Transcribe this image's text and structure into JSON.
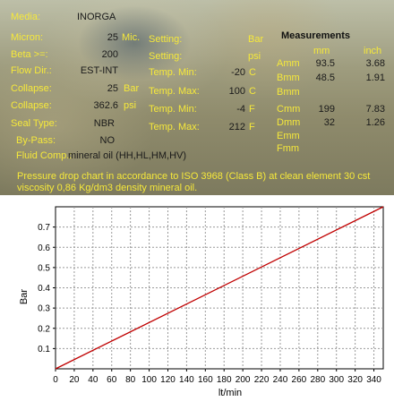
{
  "fields": {
    "media": {
      "label": "Media:",
      "value": "INORGANI"
    },
    "micron": {
      "label": "Micron:",
      "value": "25",
      "unit": "Mic."
    },
    "beta": {
      "label": "Beta >=:",
      "value": "200"
    },
    "flow_dir": {
      "label": "Flow Dir.:",
      "value": "EST-INT"
    },
    "collapse_bar": {
      "label": "Collapse:",
      "value": "25",
      "unit": "Bar"
    },
    "collapse_psi": {
      "label": "Collapse:",
      "value": "362.6",
      "unit": "psi"
    },
    "seal_type": {
      "label": "Seal Type:",
      "value": "NBR"
    },
    "by_pass": {
      "label": "By-Pass:",
      "value": "NO"
    },
    "fluid_comp": {
      "label": "Fluid Comp.:",
      "value": "mineral oil (HH,HL,HM,HV)"
    }
  },
  "settings": {
    "setting_bar": {
      "label": "Setting:",
      "value": "",
      "unit": "Bar"
    },
    "setting_psi": {
      "label": "Setting:",
      "value": "",
      "unit": "psi"
    },
    "temp_min_c": {
      "label": "Temp. Min:",
      "value": "-20",
      "unit": "C"
    },
    "temp_max_c": {
      "label": "Temp. Max:",
      "value": "100",
      "unit": "C"
    },
    "temp_min_f": {
      "label": "Temp. Min:",
      "value": "-4",
      "unit": "F"
    },
    "temp_max_f": {
      "label": "Temp. Max:",
      "value": "212",
      "unit": "F"
    }
  },
  "measurements": {
    "title": "Measurements",
    "col_mm": "mm",
    "col_inch": "inch",
    "rows": [
      {
        "label": "Amm",
        "mm": "93.5",
        "inch": "3.68"
      },
      {
        "label": "Bmm",
        "mm": "48.5",
        "inch": "1.91"
      },
      {
        "label": "Bmm",
        "mm": "",
        "inch": ""
      },
      {
        "label": "Cmm",
        "mm": "199",
        "inch": "7.83"
      },
      {
        "label": "Dmm",
        "mm": "32",
        "inch": "1.26"
      },
      {
        "label": "Emm",
        "mm": "",
        "inch": ""
      },
      {
        "label": "Fmm",
        "mm": "",
        "inch": ""
      }
    ]
  },
  "note": "Pressure drop chart in accordance to ISO 3968 (Class B) at clean element 30 cst viscosity 0,86 Kg/dm3 density mineral oil.",
  "colors": {
    "label_yellow": "#f6e93a",
    "line_red": "#c00000"
  },
  "chart_data": {
    "type": "line",
    "xlabel": "lt/min",
    "ylabel": "Bar",
    "xlim": [
      0,
      350
    ],
    "ylim": [
      0,
      0.8
    ],
    "xticks": [
      0,
      20,
      40,
      60,
      80,
      100,
      120,
      140,
      160,
      180,
      200,
      220,
      240,
      260,
      280,
      300,
      320,
      340
    ],
    "yticks": [
      0.1,
      0.2,
      0.3,
      0.4,
      0.5,
      0.6,
      0.7
    ],
    "grid": true,
    "series": [
      {
        "x": [
          0,
          350
        ],
        "y": [
          0,
          0.8
        ]
      }
    ]
  }
}
